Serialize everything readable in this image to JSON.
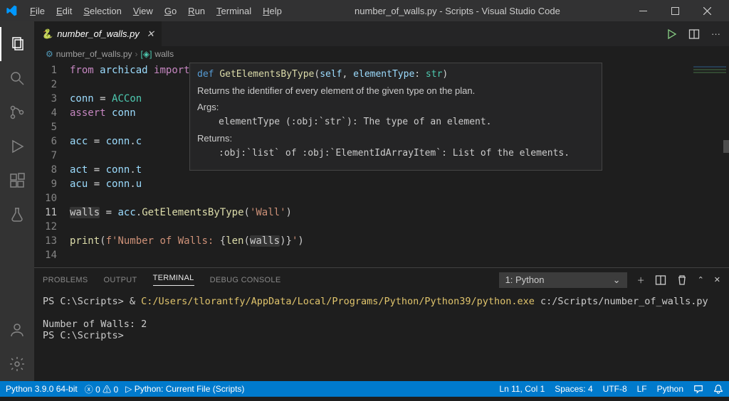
{
  "window": {
    "title": "number_of_walls.py - Scripts - Visual Studio Code"
  },
  "menubar": [
    "File",
    "Edit",
    "Selection",
    "View",
    "Go",
    "Run",
    "Terminal",
    "Help"
  ],
  "tab": {
    "filename": "number_of_walls.py"
  },
  "breadcrumb": {
    "file": "number_of_walls.py",
    "symbol": "walls"
  },
  "code": {
    "lines": [
      {
        "n": 1,
        "html": "<span class='kw'>from</span> <span class='va'>archicad</span> <span class='kw'>import</span> <span class='cls'>ACConnection</span>"
      },
      {
        "n": 2,
        "html": ""
      },
      {
        "n": 3,
        "html": "<span class='va'>conn</span> <span class='op'>=</span> <span class='cls'>ACCon</span>"
      },
      {
        "n": 4,
        "html": "<span class='kw'>assert</span> <span class='va'>conn</span>"
      },
      {
        "n": 5,
        "html": ""
      },
      {
        "n": 6,
        "html": "<span class='va'>acc</span> <span class='op'>=</span> <span class='va'>conn</span>.<span class='va'>c</span>"
      },
      {
        "n": 7,
        "html": ""
      },
      {
        "n": 8,
        "html": "<span class='va'>act</span> <span class='op'>=</span> <span class='va'>conn</span>.<span class='va'>t</span>"
      },
      {
        "n": 9,
        "html": "<span class='va'>acu</span> <span class='op'>=</span> <span class='va'>conn</span>.<span class='va'>u</span>"
      },
      {
        "n": 10,
        "html": ""
      },
      {
        "n": 11,
        "html": "<span class='hl'>walls</span> <span class='op'>=</span> <span class='va'>acc</span>.<span class='fn'>GetElementsByType</span>(<span class='str'>'Wall'</span>)",
        "current": true
      },
      {
        "n": 12,
        "html": ""
      },
      {
        "n": 13,
        "html": "<span class='bi'>print</span>(<span class='str'>f'Number of Walls: </span>{<span class='bi'>len</span>(<span class='hl'>walls</span>)}<span class='str'>'</span>)"
      },
      {
        "n": 14,
        "html": ""
      }
    ]
  },
  "hover": {
    "sig_def": "def",
    "sig_name": "GetElementsByType",
    "sig_params": "(self, elementType: str)",
    "desc": "Returns the identifier of every element of the given type on the plan.",
    "args_label": "Args:",
    "arg_line": "elementType (:obj:`str`): The type of an element.",
    "returns_label": "Returns:",
    "returns_line": ":obj:`list` of :obj:`ElementIdArrayItem`: List of the elements."
  },
  "panel": {
    "tabs": [
      "PROBLEMS",
      "OUTPUT",
      "TERMINAL",
      "DEBUG CONSOLE"
    ],
    "active": "TERMINAL",
    "select": "1: Python",
    "lines": [
      {
        "html": "PS C:\\Scripts> & <span class='yl'>C:/Users/tlorantfy/AppData/Local/Programs/Python/Python39/python.exe</span> c:/Scripts/number_of_walls.py"
      },
      {
        "html": ""
      },
      {
        "html": "Number of Walls: 2"
      },
      {
        "html": "PS C:\\Scripts>"
      }
    ]
  },
  "status": {
    "interpreter": "Python 3.9.0 64-bit",
    "errors": "0",
    "warnings": "0",
    "debug": "Python: Current File (Scripts)",
    "ln_col": "Ln 11, Col 1",
    "spaces": "Spaces: 4",
    "encoding": "UTF-8",
    "eol": "LF",
    "lang": "Python"
  }
}
